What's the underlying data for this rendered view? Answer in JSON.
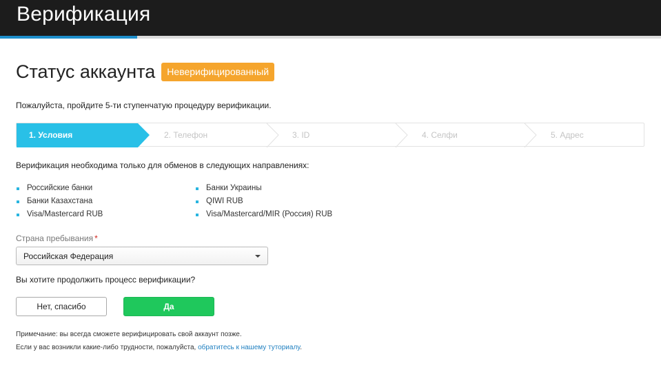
{
  "header": {
    "title": "Верификация"
  },
  "status": {
    "title": "Статус аккаунта",
    "badge": "Неверифицированный",
    "badge_color": "#f5a52d"
  },
  "intro": "Пожалуйста, пройдите 5-ти ступенчатую процедуру верификации.",
  "steps": [
    {
      "label": "1. Условия",
      "active": true
    },
    {
      "label": "2. Телефон",
      "active": false
    },
    {
      "label": "3. ID",
      "active": false
    },
    {
      "label": "4. Селфи",
      "active": false
    },
    {
      "label": "5. Адрес",
      "active": false
    }
  ],
  "directions": {
    "title": "Верификация необходима только для обменов в следующих направлениях:",
    "left": [
      "Российские банки",
      "Банки Казахстана",
      "Visa/Mastercard RUB"
    ],
    "right": [
      "Банки Украины",
      "QIWI RUB",
      "Visa/Mastercard/MIR (Россия) RUB"
    ]
  },
  "country": {
    "label": "Страна пребывания",
    "required_mark": "*",
    "value": "Российская Федерация"
  },
  "question": "Вы хотите продолжить процесс верификации?",
  "buttons": {
    "no": "Нет, спасибо",
    "yes": "Да"
  },
  "note": "Примечание: вы всегда сможете верифицировать свой аккаунт позже.",
  "help": {
    "text": "Если у вас возникли какие-либо трудности, пожалуйста, ",
    "link": "обратитесь к нашему туториалу",
    "end": "."
  },
  "colors": {
    "accent": "#1e8ecb",
    "step_active": "#29c0e7",
    "yes_button": "#1fc85c",
    "link": "#1e7fc0"
  }
}
